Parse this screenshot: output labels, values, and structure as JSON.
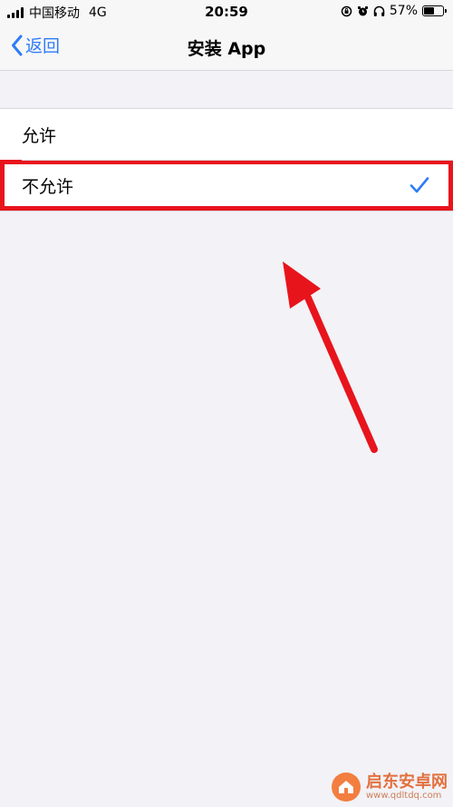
{
  "status_bar": {
    "carrier": "中国移动",
    "network": "4G",
    "time": "20:59",
    "battery_percent": "57%",
    "battery_level": 0.57,
    "icons": [
      "signal-icon",
      "orientation-lock-icon",
      "alarm-icon",
      "headphones-icon",
      "battery-icon"
    ]
  },
  "nav": {
    "back_label": "返回",
    "title": "安装 App"
  },
  "options": [
    {
      "label": "允许",
      "selected": false
    },
    {
      "label": "不允许",
      "selected": true
    }
  ],
  "colors": {
    "accent": "#2f7cf6",
    "highlight_box": "#e8141c",
    "arrow": "#e8141c",
    "background": "#f2f2f7"
  },
  "watermark": {
    "name": "启东安卓网",
    "url": "www.qdltdq.com"
  }
}
